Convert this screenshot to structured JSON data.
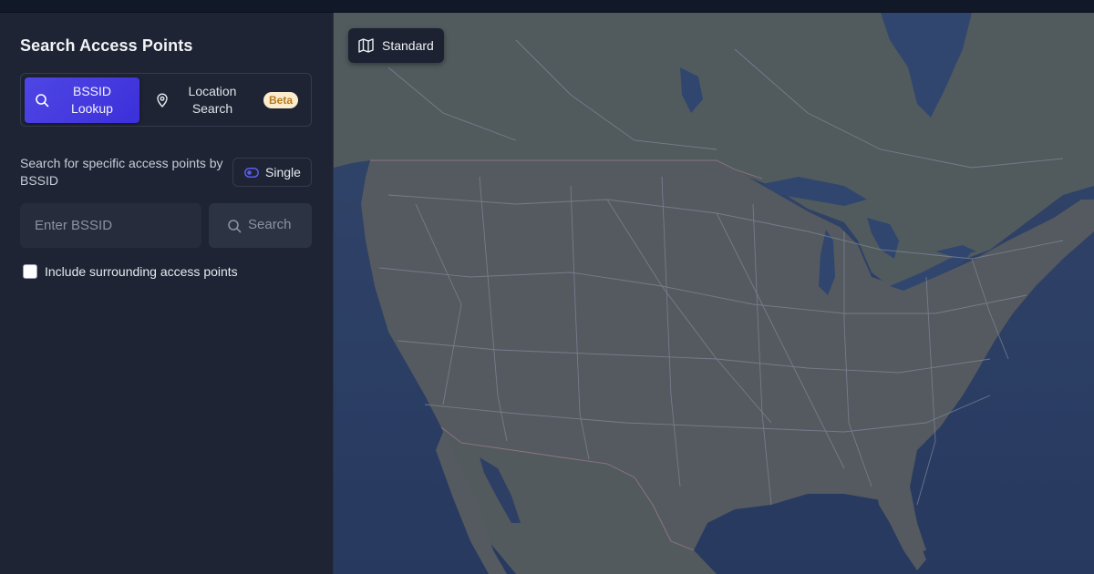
{
  "sidebar": {
    "title": "Search Access Points",
    "modes": [
      {
        "label": "BSSID Lookup",
        "icon": "search-icon",
        "active": true
      },
      {
        "label": "Location Search",
        "icon": "map-pin-icon",
        "active": false,
        "badge": "Beta"
      }
    ],
    "description": "Search for specific access points by BSSID",
    "single_toggle": {
      "label": "Single",
      "icon": "toggle-icon"
    },
    "bssid_input": {
      "placeholder": "Enter BSSID",
      "value": ""
    },
    "search_button": {
      "label": "Search",
      "icon": "search-icon"
    },
    "include_surrounding": {
      "label": "Include surrounding access points",
      "checked": false
    }
  },
  "map": {
    "style_button": {
      "label": "Standard",
      "icon": "map-icon"
    }
  },
  "colors": {
    "accent": "#4f46e5",
    "sidebar_bg": "#1e2433",
    "badge_bg": "#fbeccd",
    "badge_text": "#b9791d",
    "ocean": "#2c4068",
    "land": "#555b5c"
  }
}
